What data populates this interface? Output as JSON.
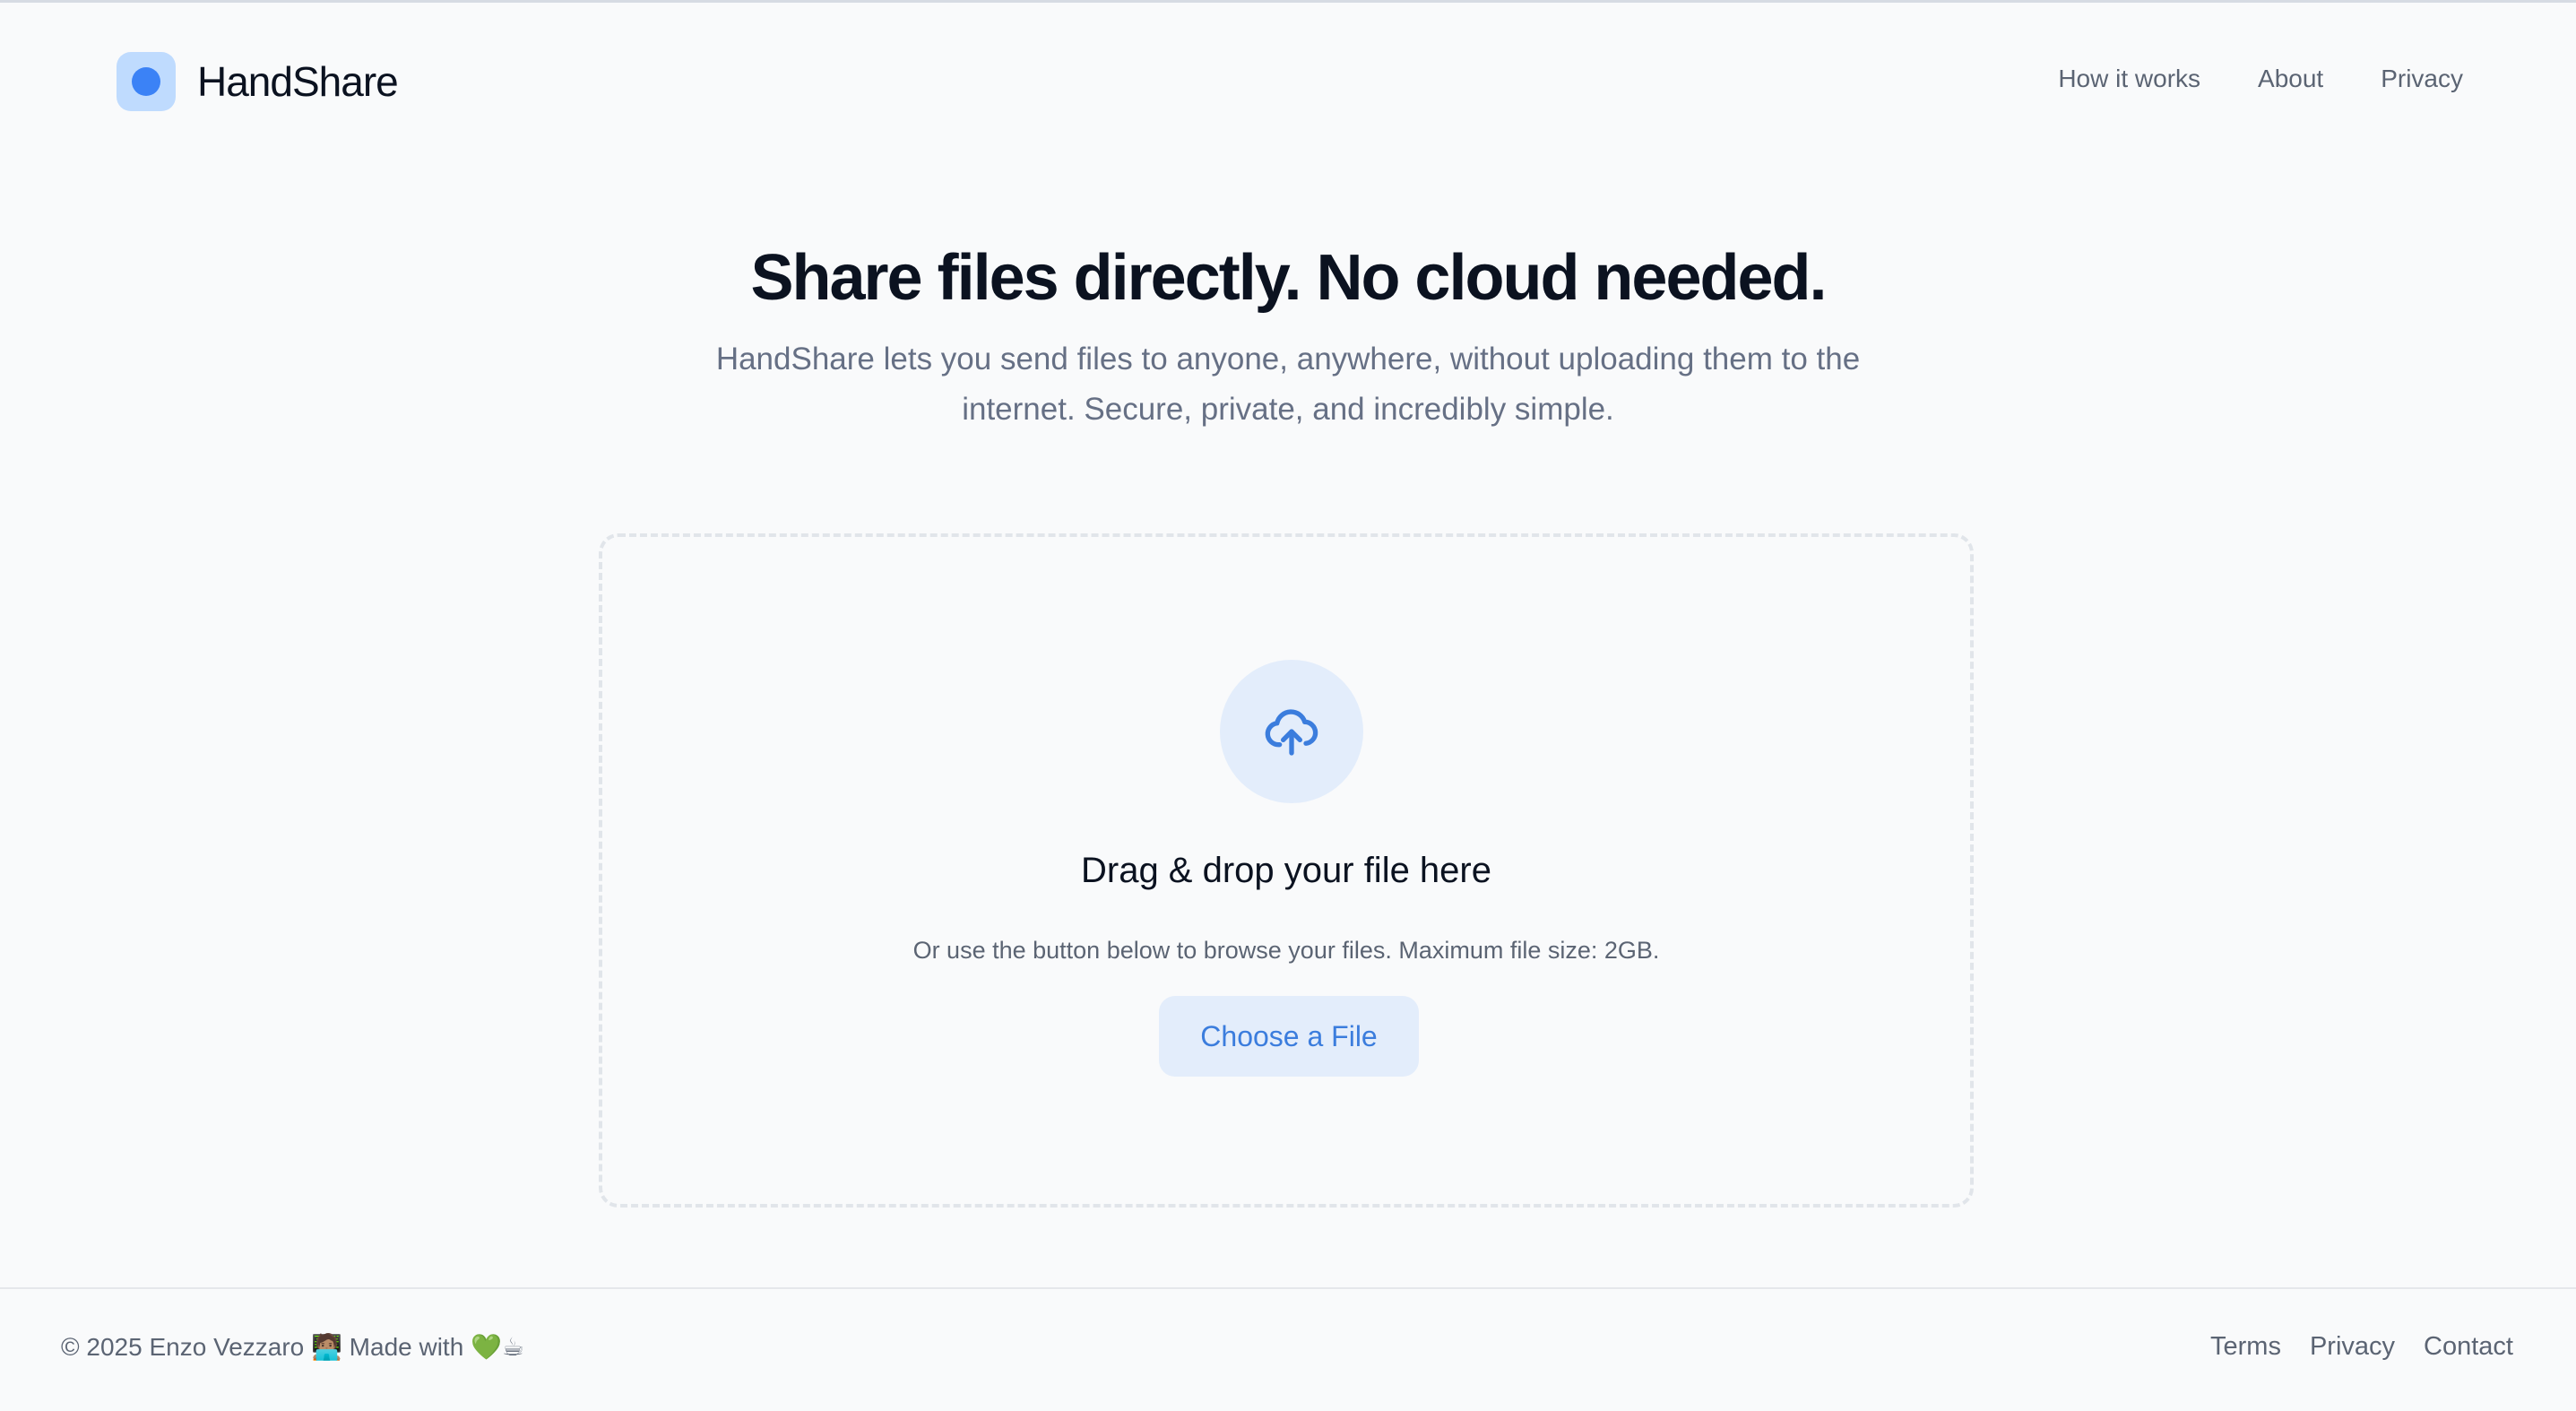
{
  "brand": {
    "name": "HandShare",
    "logo_icon": "dot-logo-icon",
    "accent_color": "#3b82f6"
  },
  "nav": {
    "items": [
      {
        "label": "How it works"
      },
      {
        "label": "About"
      },
      {
        "label": "Privacy"
      }
    ]
  },
  "hero": {
    "title": "Share files directly. No cloud needed.",
    "subtitle": "HandShare lets you send files to anyone, anywhere, without uploading them to the internet. Secure, private, and incredibly simple."
  },
  "dropzone": {
    "icon": "cloud-upload-icon",
    "title": "Drag & drop your file here",
    "hint": "Or use the button below to browse your files. Maximum file size: 2GB.",
    "button_label": "Choose a File"
  },
  "footer": {
    "copyright": "© 2025 Enzo Vezzaro 🧑🏽‍💻 Made with 💚☕",
    "links": [
      {
        "label": "Terms"
      },
      {
        "label": "Privacy"
      },
      {
        "label": "Contact"
      }
    ]
  }
}
